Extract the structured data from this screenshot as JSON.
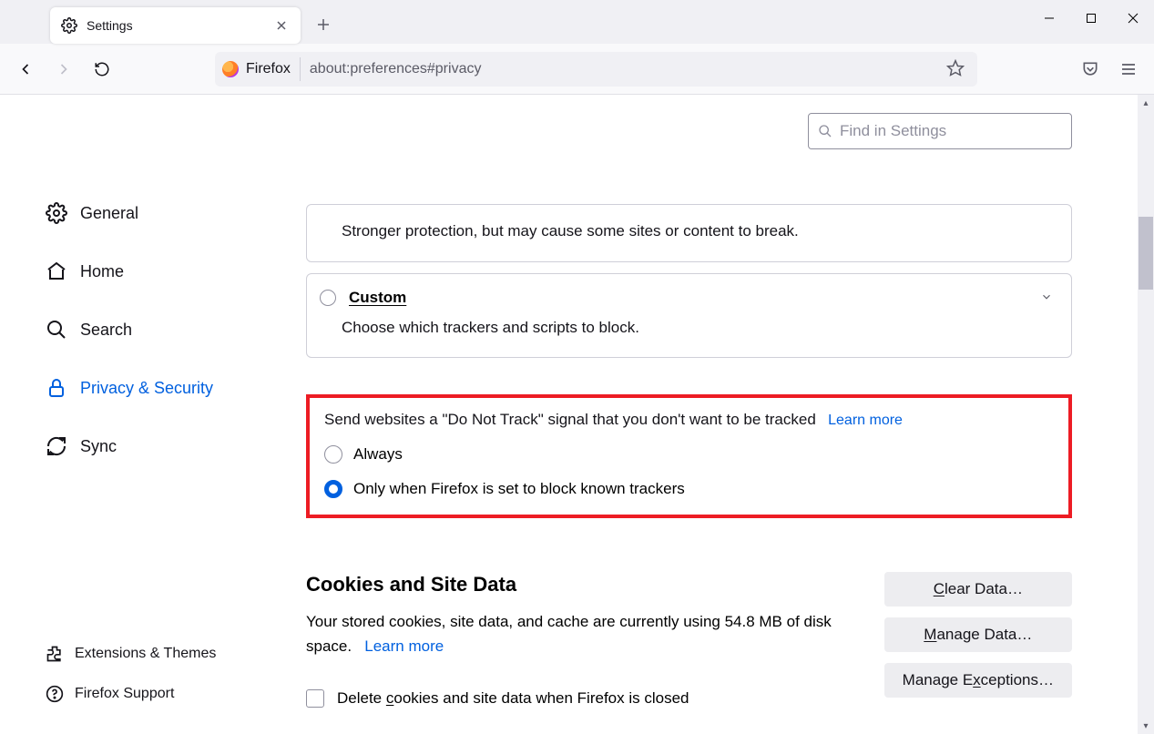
{
  "tab": {
    "title": "Settings"
  },
  "urlbar": {
    "brand": "Firefox",
    "address": "about:preferences#privacy"
  },
  "search": {
    "placeholder": "Find in Settings"
  },
  "sidebar": {
    "items": [
      {
        "label": "General"
      },
      {
        "label": "Home"
      },
      {
        "label": "Search"
      },
      {
        "label": "Privacy & Security"
      },
      {
        "label": "Sync"
      }
    ],
    "footer": [
      {
        "label": "Extensions & Themes"
      },
      {
        "label": "Firefox Support"
      }
    ]
  },
  "protection": {
    "strict_desc": "Stronger protection, but may cause some sites or content to break.",
    "custom_title": "Custom",
    "custom_desc": "Choose which trackers and scripts to block."
  },
  "dnt": {
    "prompt": "Send websites a \"Do Not Track\" signal that you don't want to be tracked",
    "learn": "Learn more",
    "opt_always": "Always",
    "opt_auto": "Only when Firefox is set to block known trackers"
  },
  "cookies": {
    "heading": "Cookies and Site Data",
    "usage_a": "Your stored cookies, site data, and cache are currently using 54.8 MB of disk space.",
    "learn": "Learn more",
    "delete_on_close": "Delete cookies and site data when Firefox is closed",
    "btn_clear_pref": "C",
    "btn_clear_rest": "lear Data…",
    "btn_manage_pref": "M",
    "btn_manage_rest": "anage Data…",
    "btn_exc_pref": "Manage E",
    "btn_exc_rest": "xceptions…"
  }
}
